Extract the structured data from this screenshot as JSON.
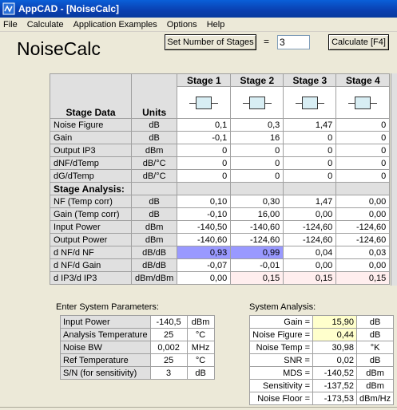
{
  "window": {
    "title": "AppCAD - [NoiseCalc]"
  },
  "menu": [
    "File",
    "Calculate",
    "Application Examples",
    "Options",
    "Help"
  ],
  "page_title": "NoiseCalc",
  "toolbar": {
    "set_stages_label": "Set Number of Stages",
    "equals": "=",
    "stages_value": "3",
    "calculate_label": "Calculate [F4]"
  },
  "grid": {
    "header": {
      "stage_data": "Stage Data",
      "units": "Units",
      "stages": [
        "Stage  1",
        "Stage  2",
        "Stage  3",
        "Stage  4"
      ]
    },
    "stage_data_rows": [
      {
        "label": "Noise Figure",
        "unit": "dB",
        "values": [
          "0,1",
          "0,3",
          "1,47",
          "0"
        ]
      },
      {
        "label": "Gain",
        "unit": "dB",
        "values": [
          "-0,1",
          "16",
          "0",
          "0"
        ]
      },
      {
        "label": "Output IP3",
        "unit": "dBm",
        "values": [
          "0",
          "0",
          "0",
          "0"
        ]
      },
      {
        "label": "dNF/dTemp",
        "unit": "dB/°C",
        "values": [
          "0",
          "0",
          "0",
          "0"
        ]
      },
      {
        "label": "dG/dTemp",
        "unit": "dB/°C",
        "values": [
          "0",
          "0",
          "0",
          "0"
        ]
      }
    ],
    "analysis_header": "Stage Analysis:",
    "analysis_rows": [
      {
        "label": "NF (Temp corr)",
        "unit": "dB",
        "values": [
          "0,10",
          "0,30",
          "1,47",
          "0,00"
        ]
      },
      {
        "label": "Gain (Temp corr)",
        "unit": "dB",
        "values": [
          "-0,10",
          "16,00",
          "0,00",
          "0,00"
        ]
      },
      {
        "label": "Input Power",
        "unit": "dBm",
        "values": [
          "-140,50",
          "-140,60",
          "-124,60",
          "-124,60"
        ]
      },
      {
        "label": "Output Power",
        "unit": "dBm",
        "values": [
          "-140,60",
          "-124,60",
          "-124,60",
          "-124,60"
        ]
      },
      {
        "label": "d NF/d NF",
        "unit": "dB/dB",
        "values": [
          "0,93",
          "0,99",
          "0,04",
          "0,03"
        ]
      },
      {
        "label": "d NF/d Gain",
        "unit": "dB/dB",
        "values": [
          "-0,07",
          "-0,01",
          "0,00",
          "0,00"
        ]
      },
      {
        "label": "d IP3/d IP3",
        "unit": "dBm/dBm",
        "values": [
          "0,00",
          "0,15",
          "0,15",
          "0,15"
        ]
      }
    ]
  },
  "system_params": {
    "title": "Enter System Parameters:",
    "rows": [
      {
        "label": "Input Power",
        "value": "-140,5",
        "unit": "dBm"
      },
      {
        "label": "Analysis Temperature",
        "value": "25",
        "unit": "°C"
      },
      {
        "label": "Noise BW",
        "value": "0,002",
        "unit": "MHz"
      },
      {
        "label": "Ref Temperature",
        "value": "25",
        "unit": "°C"
      },
      {
        "label": "S/N (for sensitivity)",
        "value": "3",
        "unit": "dB"
      }
    ]
  },
  "system_analysis": {
    "title": "System Analysis:",
    "rows": [
      {
        "label": "Gain =",
        "value": "15,90",
        "unit": "dB"
      },
      {
        "label": "Noise Figure =",
        "value": "0,44",
        "unit": "dB"
      },
      {
        "label": "Noise Temp =",
        "value": "30,98",
        "unit": "°K"
      },
      {
        "label": "SNR =",
        "value": "0,02",
        "unit": "dB"
      },
      {
        "label": "MDS =",
        "value": "-140,52",
        "unit": "dBm"
      },
      {
        "label": "Sensitivity =",
        "value": "-137,52",
        "unit": "dBm"
      },
      {
        "label": "Noise Floor =",
        "value": "-173,53",
        "unit": "dBm/Hz"
      }
    ]
  },
  "colors": {
    "highlight": "#9999ff",
    "pink": "#ffeeee",
    "yellow": "#ffffcc"
  }
}
